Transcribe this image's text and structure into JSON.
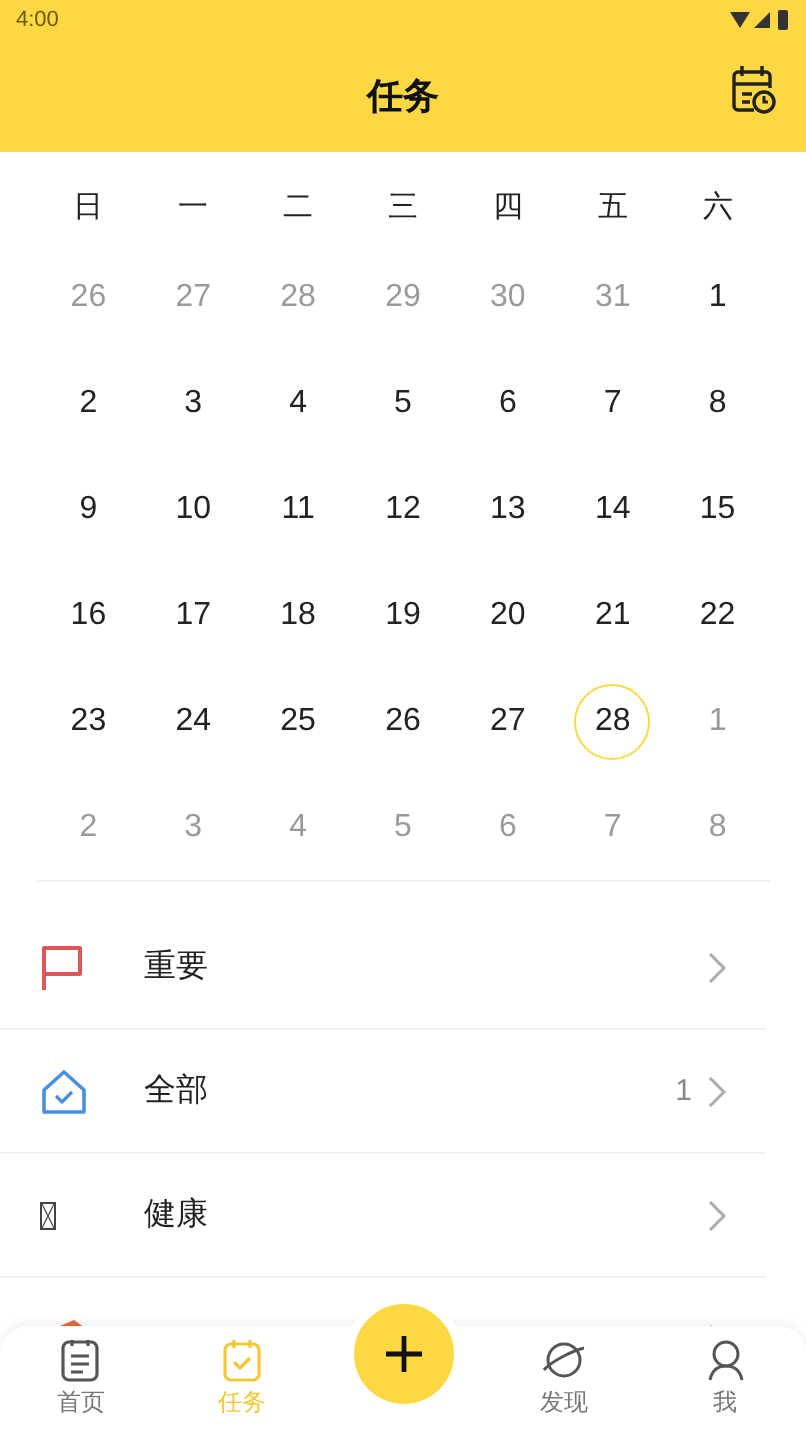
{
  "status_bar": {
    "time": "4:00"
  },
  "header": {
    "title": "任务"
  },
  "calendar": {
    "weekdays": [
      "日",
      "一",
      "二",
      "三",
      "四",
      "五",
      "六"
    ],
    "days": [
      {
        "label": "26",
        "muted": true,
        "selected": false
      },
      {
        "label": "27",
        "muted": true,
        "selected": false
      },
      {
        "label": "28",
        "muted": true,
        "selected": false
      },
      {
        "label": "29",
        "muted": true,
        "selected": false
      },
      {
        "label": "30",
        "muted": true,
        "selected": false
      },
      {
        "label": "31",
        "muted": true,
        "selected": false
      },
      {
        "label": "1",
        "muted": false,
        "selected": false
      },
      {
        "label": "2",
        "muted": false,
        "selected": false
      },
      {
        "label": "3",
        "muted": false,
        "selected": false
      },
      {
        "label": "4",
        "muted": false,
        "selected": false
      },
      {
        "label": "5",
        "muted": false,
        "selected": false
      },
      {
        "label": "6",
        "muted": false,
        "selected": false
      },
      {
        "label": "7",
        "muted": false,
        "selected": false
      },
      {
        "label": "8",
        "muted": false,
        "selected": false
      },
      {
        "label": "9",
        "muted": false,
        "selected": false
      },
      {
        "label": "10",
        "muted": false,
        "selected": false
      },
      {
        "label": "11",
        "muted": false,
        "selected": false
      },
      {
        "label": "12",
        "muted": false,
        "selected": false
      },
      {
        "label": "13",
        "muted": false,
        "selected": false
      },
      {
        "label": "14",
        "muted": false,
        "selected": false
      },
      {
        "label": "15",
        "muted": false,
        "selected": false
      },
      {
        "label": "16",
        "muted": false,
        "selected": false
      },
      {
        "label": "17",
        "muted": false,
        "selected": false
      },
      {
        "label": "18",
        "muted": false,
        "selected": false
      },
      {
        "label": "19",
        "muted": false,
        "selected": false
      },
      {
        "label": "20",
        "muted": false,
        "selected": false
      },
      {
        "label": "21",
        "muted": false,
        "selected": false
      },
      {
        "label": "22",
        "muted": false,
        "selected": false
      },
      {
        "label": "23",
        "muted": false,
        "selected": false
      },
      {
        "label": "24",
        "muted": false,
        "selected": false
      },
      {
        "label": "25",
        "muted": false,
        "selected": false
      },
      {
        "label": "26",
        "muted": false,
        "selected": false
      },
      {
        "label": "27",
        "muted": false,
        "selected": false
      },
      {
        "label": "28",
        "muted": false,
        "selected": true
      },
      {
        "label": "1",
        "muted": true,
        "selected": false
      },
      {
        "label": "2",
        "muted": true,
        "selected": false
      },
      {
        "label": "3",
        "muted": true,
        "selected": false
      },
      {
        "label": "4",
        "muted": true,
        "selected": false
      },
      {
        "label": "5",
        "muted": true,
        "selected": false
      },
      {
        "label": "6",
        "muted": true,
        "selected": false
      },
      {
        "label": "7",
        "muted": true,
        "selected": false
      },
      {
        "label": "8",
        "muted": true,
        "selected": false
      }
    ]
  },
  "lists": [
    {
      "kind": "flag",
      "label": "重要"
    },
    {
      "kind": "home",
      "label": "全部",
      "count": "1"
    },
    {
      "kind": "missing",
      "label": "健康"
    },
    {
      "kind": "book"
    }
  ],
  "bottom_nav": [
    {
      "kind": "doc",
      "label": "首页",
      "selected": false
    },
    {
      "kind": "calendar",
      "label": "任务",
      "selected": true
    },
    {
      "kind": "add"
    },
    {
      "kind": "planet",
      "label": "发现",
      "selected": false
    },
    {
      "kind": "person",
      "label": "我",
      "selected": false
    }
  ]
}
